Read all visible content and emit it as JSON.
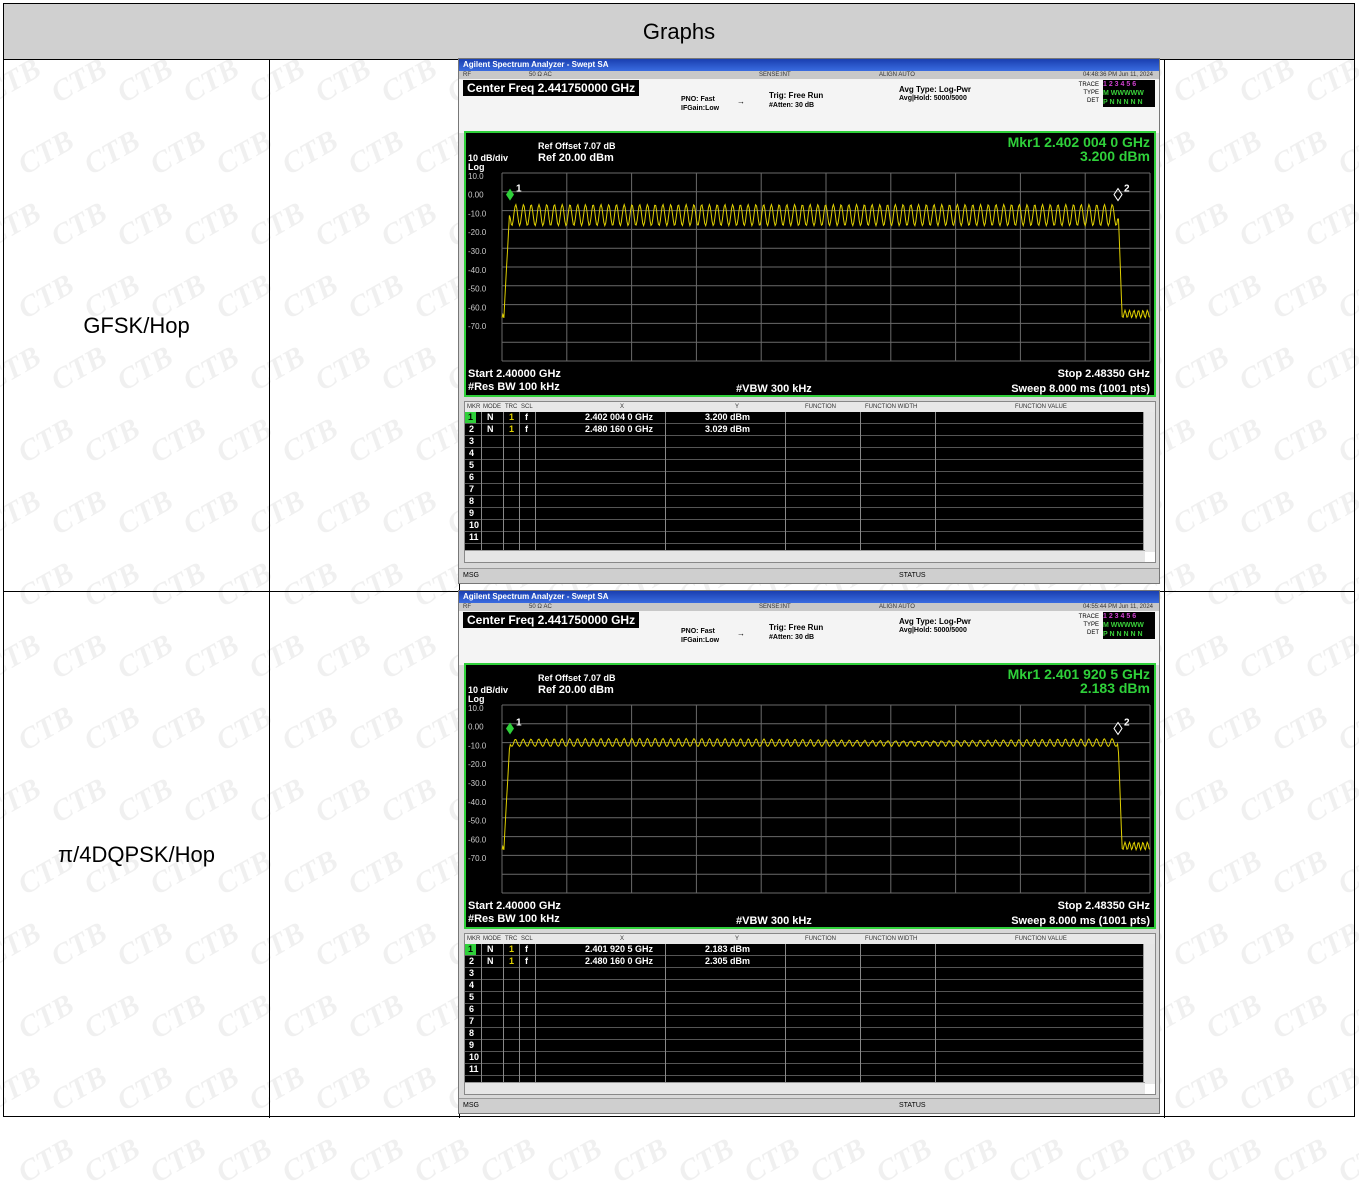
{
  "header": {
    "title": "Graphs"
  },
  "rows": [
    {
      "label": "GFSK/Hop",
      "analyzer": {
        "app_title": "Agilent Spectrum Analyzer - Swept SA",
        "sense": "SENSE:INT",
        "align": "ALIGN AUTO",
        "rf": "RF",
        "ohm": "50 Ω  AC",
        "timestamp": "04:48:36 PM Jun 11, 2024",
        "center_freq": "Center Freq 2.441750000 GHz",
        "pno": "PNO: Fast",
        "ifgain": "IFGain:Low",
        "trig": "Trig: Free Run",
        "atten": "#Atten: 30 dB",
        "avg_type": "Avg Type: Log-Pwr",
        "avg_hold": "Avg|Hold: 5000/5000",
        "trace": "TRACE",
        "type": "TYPE",
        "det": "DET",
        "trace_digits": "1 2 3 4 5 6",
        "type_letters": "M WWWWW",
        "det_letters": "P N N N N N",
        "ref_offset": "Ref Offset 7.07 dB",
        "scale": "10 dB/div",
        "ref_level": "Ref 20.00 dBm",
        "log": "Log",
        "mkr_freq": "Mkr1 2.402 004 0 GHz",
        "mkr_amp": "3.200 dBm",
        "start": "Start 2.40000 GHz",
        "stop": "Stop 2.48350 GHz",
        "rbw": "#Res BW 100 kHz",
        "vbw": "#VBW 300 kHz",
        "sweep": "Sweep  8.000 ms (1001 pts)",
        "marker1_label": "1",
        "marker2_label": "2",
        "y_ticks": [
          "10.0",
          "0.00",
          "-10.0",
          "-20.0",
          "-30.0",
          "-40.0",
          "-50.0",
          "-60.0",
          "-70.0"
        ],
        "table_headers": [
          "MKR",
          "MODE",
          "TRC",
          "SCL",
          "X",
          "Y",
          "FUNCTION",
          "FUNCTION WIDTH",
          "FUNCTION VALUE"
        ],
        "markers": [
          {
            "n": "1",
            "mode": "N",
            "trc": "1",
            "scl": "f",
            "x": "2.402 004 0 GHz",
            "y": "3.200 dBm"
          },
          {
            "n": "2",
            "mode": "N",
            "trc": "1",
            "scl": "f",
            "x": "2.480 160 0 GHz",
            "y": "3.029 dBm"
          }
        ],
        "empty_rows": [
          "3",
          "4",
          "5",
          "6",
          "7",
          "8",
          "9",
          "10",
          "11"
        ],
        "msg": "MSG",
        "status": "STATUS",
        "chart_data": {
          "type": "line",
          "x_range": [
            2.4,
            2.4835
          ],
          "ylim": [
            -80,
            20
          ],
          "pattern": "hopping-comb",
          "peak_level": 3.2,
          "trough_level": -8,
          "floor_level": -55,
          "hop_channels": 79,
          "trace_color": "#e0d000"
        }
      }
    },
    {
      "label": "π/4DQPSK/Hop",
      "analyzer": {
        "app_title": "Agilent Spectrum Analyzer - Swept SA",
        "sense": "SENSE:INT",
        "align": "ALIGN AUTO",
        "rf": "RF",
        "ohm": "50 Ω  AC",
        "timestamp": "04:55:44 PM Jun 11, 2024",
        "center_freq": "Center Freq 2.441750000 GHz",
        "pno": "PNO: Fast",
        "ifgain": "IFGain:Low",
        "trig": "Trig: Free Run",
        "atten": "#Atten: 30 dB",
        "avg_type": "Avg Type: Log-Pwr",
        "avg_hold": "Avg|Hold: 5000/5000",
        "trace": "TRACE",
        "type": "TYPE",
        "det": "DET",
        "trace_digits": "1 2 3 4 5 6",
        "type_letters": "M WWWWW",
        "det_letters": "P N N N N N",
        "ref_offset": "Ref Offset 7.07 dB",
        "scale": "10 dB/div",
        "ref_level": "Ref 20.00 dBm",
        "log": "Log",
        "mkr_freq": "Mkr1 2.401 920 5 GHz",
        "mkr_amp": "2.183 dBm",
        "start": "Start 2.40000 GHz",
        "stop": "Stop 2.48350 GHz",
        "rbw": "#Res BW 100 kHz",
        "vbw": "#VBW 300 kHz",
        "sweep": "Sweep  8.000 ms (1001 pts)",
        "marker1_label": "1",
        "marker2_label": "2",
        "y_ticks": [
          "10.0",
          "0.00",
          "-10.0",
          "-20.0",
          "-30.0",
          "-40.0",
          "-50.0",
          "-60.0",
          "-70.0"
        ],
        "table_headers": [
          "MKR",
          "MODE",
          "TRC",
          "SCL",
          "X",
          "Y",
          "FUNCTION",
          "FUNCTION WIDTH",
          "FUNCTION VALUE"
        ],
        "markers": [
          {
            "n": "1",
            "mode": "N",
            "trc": "1",
            "scl": "f",
            "x": "2.401 920 5 GHz",
            "y": "2.183 dBm"
          },
          {
            "n": "2",
            "mode": "N",
            "trc": "1",
            "scl": "f",
            "x": "2.480 160 0 GHz",
            "y": "2.305 dBm"
          }
        ],
        "empty_rows": [
          "3",
          "4",
          "5",
          "6",
          "7",
          "8",
          "9",
          "10",
          "11"
        ],
        "msg": "MSG",
        "status": "STATUS",
        "chart_data": {
          "type": "line",
          "x_range": [
            2.4,
            2.4835
          ],
          "ylim": [
            -80,
            20
          ],
          "pattern": "hopping-flat",
          "peak_level": 2.2,
          "trough_level": -2,
          "floor_level": -55,
          "hop_channels": 79,
          "trace_color": "#e0d000"
        }
      }
    }
  ]
}
